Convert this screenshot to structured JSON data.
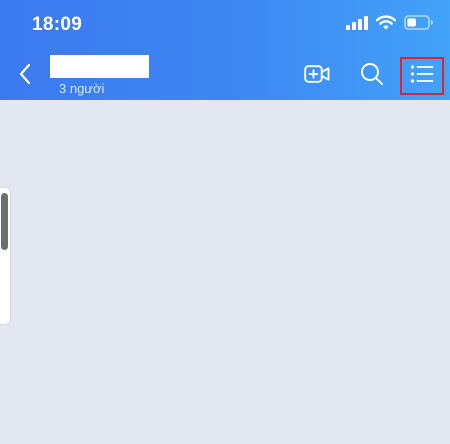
{
  "status_bar": {
    "time": "18:09",
    "icons": [
      "signal-icon",
      "wifi-icon",
      "battery-icon"
    ],
    "battery_level": 0.35
  },
  "header": {
    "back_icon": "chevron-left-icon",
    "subtitle": "3 người",
    "actions": [
      "video-call-add-icon",
      "search-icon",
      "list-menu-icon"
    ],
    "highlight_color": "#e0242b"
  },
  "colors": {
    "header_gradient_start": "#3b79f0",
    "header_gradient_end": "#42a3f8",
    "content_background": "#e3e7ef"
  }
}
